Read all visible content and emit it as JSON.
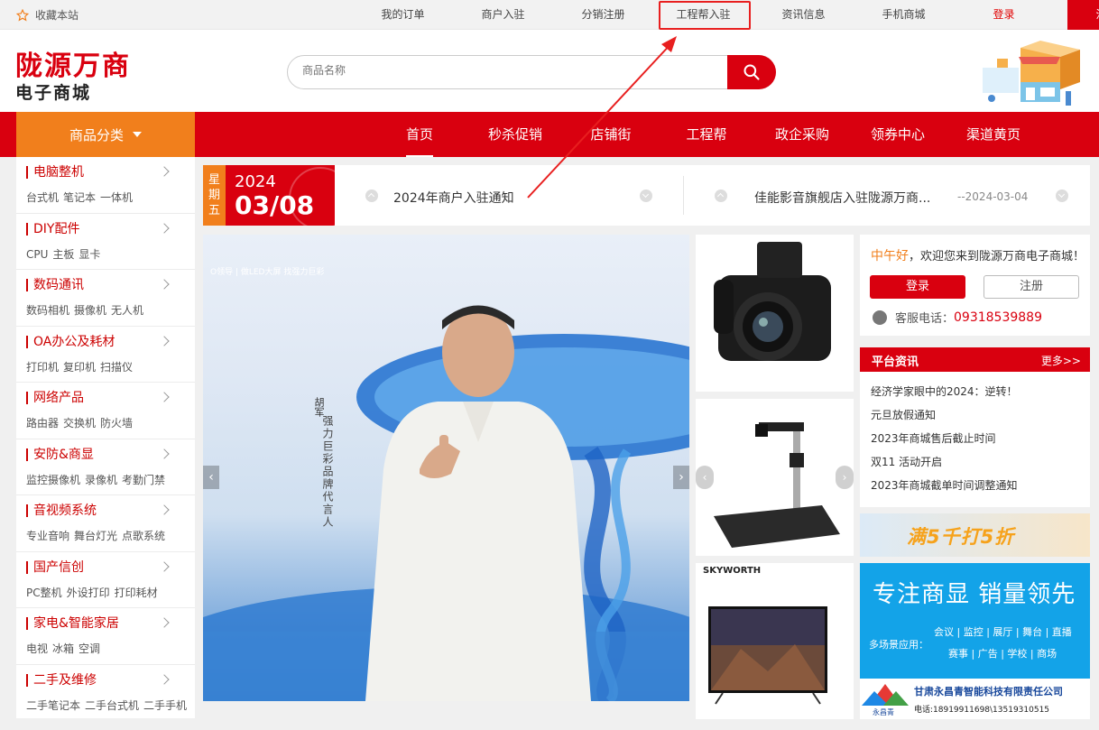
{
  "topbar": {
    "favorite_label": "收藏本站",
    "links": [
      "我的订单",
      "商户入驻",
      "分销注册",
      "工程帮入驻",
      "资讯信息",
      "手机商城"
    ],
    "login_label": "登录",
    "register_label": "注册"
  },
  "header": {
    "logo_title": "陇源万商",
    "logo_subtitle": "电子商城",
    "search_placeholder": "商品名称"
  },
  "nav": {
    "category_button": "商品分类",
    "items": [
      "首页",
      "秒杀促销",
      "店铺街",
      "工程帮",
      "政企采购",
      "领券中心",
      "渠道黄页"
    ]
  },
  "categories": [
    {
      "title": "电脑整机",
      "subs": [
        "台式机",
        "笔记本",
        "一体机"
      ]
    },
    {
      "title": "DIY配件",
      "subs": [
        "CPU",
        "主板",
        "显卡"
      ]
    },
    {
      "title": "数码通讯",
      "subs": [
        "数码相机",
        "摄像机",
        "无人机"
      ]
    },
    {
      "title": "OA办公及耗材",
      "subs": [
        "打印机",
        "复印机",
        "扫描仪"
      ]
    },
    {
      "title": "网络产品",
      "subs": [
        "路由器",
        "交换机",
        "防火墙"
      ]
    },
    {
      "title": "安防&商显",
      "subs": [
        "监控摄像机",
        "录像机",
        "考勤门禁"
      ]
    },
    {
      "title": "音视频系统",
      "subs": [
        "专业音响",
        "舞台灯光",
        "点歌系统"
      ]
    },
    {
      "title": "国产信创",
      "subs": [
        "PC整机",
        "外设打印",
        "打印耗材"
      ]
    },
    {
      "title": "家电&智能家居",
      "subs": [
        "电视",
        "冰箱",
        "空调"
      ]
    },
    {
      "title": "二手及维修",
      "subs": [
        "二手笔记本",
        "二手台式机",
        "二手手机"
      ]
    }
  ],
  "datebox": {
    "weekday": "星期五",
    "year": "2024",
    "month_day": "03/08"
  },
  "notices": [
    {
      "text": "2024年商户入驻通知"
    },
    {
      "text": "佳能影音旗舰店入驻陇源万商...",
      "date": "--2024-03-04"
    }
  ],
  "banner": {
    "brand_line": "O领导 | 做LED大屏  找强力巨彩",
    "person_name": "胡军",
    "tagline": "强力巨彩品牌代言人"
  },
  "products": {
    "tv_brand": "SKYWORTH"
  },
  "userbox": {
    "greeting_time": "中午好",
    "greeting_rest": "，欢迎您来到陇源万商电子商城！",
    "login_label": "登录",
    "register_label": "注册",
    "phone_label": "客服电话：",
    "phone_number": "09318539889"
  },
  "platform_news": {
    "title": "平台资讯",
    "more": "更多>>",
    "items": [
      "经济学家眼中的2024：逆转！",
      "元旦放假通知",
      "2023年商城售后截止时间",
      "双11 活动开启",
      "2023年商城截单时间调整通知"
    ]
  },
  "promo": {
    "text": "满5千打5折"
  },
  "ad": {
    "title": "专注商显  销量领先",
    "scene_label": "多场景应用：",
    "line1": "会议 | 监控 | 展厅 | 舞台 | 直播",
    "line2": "赛事 | 广告 | 学校 | 商场",
    "company": "甘肃永昌青智能科技有限责任公司",
    "tel": "电话:18919911698\\13519310515",
    "brand": "永昌青"
  },
  "colors": {
    "primary_red": "#d9000f",
    "accent_orange": "#f17f1c",
    "ad_blue": "#13a3e8"
  }
}
